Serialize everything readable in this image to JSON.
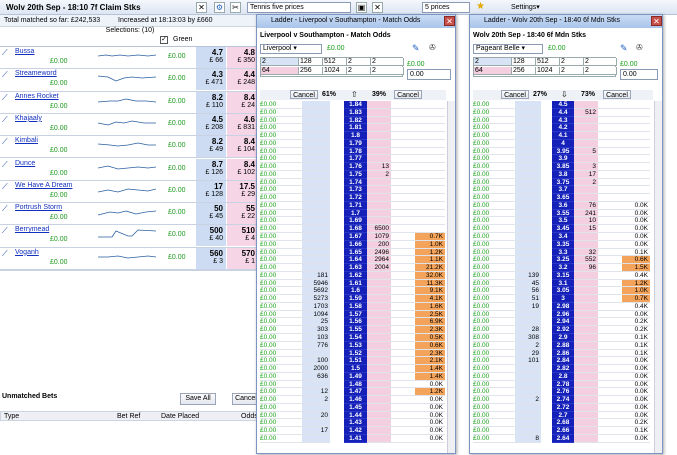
{
  "main": {
    "title": "Wolv 20th Sep - 18:10 7f Claim Stks",
    "total_matched": "Total matched so far: £242,533",
    "increased": "Increased at 18:13:03 by £660",
    "selections": "Selections: (10)",
    "green_label": "Green",
    "preset": "Tennis five prices",
    "preset2": "5 prices",
    "settings": "Settings",
    "runners": [
      {
        "name": "Bussa",
        "pl": "£0.00",
        "pl2": "£0.00",
        "back": "4.7",
        "back_size": "£ 66",
        "lay": "4.8",
        "lay_size": "£ 350"
      },
      {
        "name": "Streameword",
        "pl": "£0.00",
        "pl2": "£0.00",
        "back": "4.3",
        "back_size": "£ 471",
        "lay": "4.4",
        "lay_size": "£ 248"
      },
      {
        "name": "Annes Rocket",
        "pl": "£0.00",
        "pl2": "£0.00",
        "back": "8.2",
        "back_size": "£ 110",
        "lay": "8.4",
        "lay_size": "£ 24"
      },
      {
        "name": "Khajaaly",
        "pl": "£0.00",
        "pl2": "£0.00",
        "back": "4.5",
        "back_size": "£ 208",
        "lay": "4.6",
        "lay_size": "£ 831"
      },
      {
        "name": "Kimbali",
        "pl": "£0.00",
        "pl2": "£0.00",
        "back": "8.2",
        "back_size": "£ 49",
        "lay": "8.4",
        "lay_size": "£ 104"
      },
      {
        "name": "Dunce",
        "pl": "£0.00",
        "pl2": "£0.00",
        "back": "8.7",
        "back_size": "£ 126",
        "lay": "8.4",
        "lay_size": "£ 102"
      },
      {
        "name": "We Have A Dream",
        "pl": "£0.00",
        "pl2": "£0.00",
        "back": "17",
        "back_size": "£ 128",
        "lay": "17.5",
        "lay_size": "£ 29"
      },
      {
        "name": "Portrush Storm",
        "pl": "£0.00",
        "pl2": "£0.00",
        "back": "50",
        "back_size": "£ 45",
        "lay": "55",
        "lay_size": "£ 22"
      },
      {
        "name": "Berrymead",
        "pl": "£0.00",
        "pl2": "£0.00",
        "back": "500",
        "back_size": "£ 40",
        "lay": "510",
        "lay_size": "£ 4"
      },
      {
        "name": "Voganh",
        "pl": "£0.00",
        "pl2": "£0.00",
        "back": "560",
        "back_size": "£ 3",
        "lay": "570",
        "lay_size": "£ 1"
      }
    ],
    "unmatched_title": "Unmatched Bets",
    "save_all": "Save All",
    "cancel": "Cancel",
    "cols": [
      "Type",
      "Bet Ref",
      "Date Placed",
      "Odds"
    ]
  },
  "ladder1": {
    "title": "Ladder - Liverpool v Southampton - Match Odds",
    "market": "Liverpool v Southampton - Match Odds",
    "selection": "Liverpool",
    "pl": "£0.00",
    "stakes_row1": [
      "2",
      "128",
      "512",
      "2",
      "2"
    ],
    "stakes_row2": [
      "64",
      "256",
      "1024",
      "2",
      "2"
    ],
    "pl_box": "£0.00",
    "stake_box": "0.00",
    "cancel_l": "Cancel",
    "pct_back": "61%",
    "pct_lay": "39%",
    "cancel_r": "Cancel",
    "rows": [
      [
        "£0.00",
        "",
        "1.84",
        "",
        "",
        ""
      ],
      [
        "£0.00",
        "",
        "1.83",
        "",
        "",
        ""
      ],
      [
        "£0.00",
        "",
        "1.82",
        "",
        "",
        ""
      ],
      [
        "£0.00",
        "",
        "1.81",
        "",
        "",
        ""
      ],
      [
        "£0.00",
        "",
        "1.8",
        "",
        "",
        ""
      ],
      [
        "£0.00",
        "",
        "1.79",
        "",
        "",
        ""
      ],
      [
        "£0.00",
        "",
        "1.78",
        "",
        "",
        ""
      ],
      [
        "£0.00",
        "",
        "1.77",
        "",
        "",
        ""
      ],
      [
        "£0.00",
        "",
        "1.76",
        "13",
        "",
        ""
      ],
      [
        "£0.00",
        "",
        "1.75",
        "2",
        "",
        ""
      ],
      [
        "£0.00",
        "",
        "1.74",
        "",
        "",
        ""
      ],
      [
        "£0.00",
        "",
        "1.73",
        "",
        "",
        ""
      ],
      [
        "£0.00",
        "",
        "1.72",
        "",
        "",
        ""
      ],
      [
        "£0.00",
        "",
        "1.71",
        "",
        "",
        ""
      ],
      [
        "£0.00",
        "",
        "1.7",
        "",
        "",
        ""
      ],
      [
        "£0.00",
        "",
        "1.69",
        "",
        "",
        ""
      ],
      [
        "£0.00",
        "",
        "1.68",
        "6500",
        "",
        ""
      ],
      [
        "£0.00",
        "",
        "1.67",
        "1079",
        "",
        "0.7K"
      ],
      [
        "£0.00",
        "",
        "1.66",
        "200",
        "",
        "1.0K"
      ],
      [
        "£0.00",
        "",
        "1.65",
        "2496",
        "",
        "1.2K"
      ],
      [
        "£0.00",
        "",
        "1.64",
        "2964",
        "",
        "1.1K"
      ],
      [
        "£0.00",
        "",
        "1.63",
        "2004",
        "",
        "21.2K"
      ],
      [
        "£0.00",
        "181",
        "1.62",
        "",
        "",
        "32.0K"
      ],
      [
        "£0.00",
        "5946",
        "1.61",
        "",
        "",
        "11.3K"
      ],
      [
        "£0.00",
        "5692",
        "1.6",
        "",
        "",
        "9.1K"
      ],
      [
        "£0.00",
        "5273",
        "1.59",
        "",
        "",
        "4.1K"
      ],
      [
        "£0.00",
        "1703",
        "1.58",
        "",
        "",
        "1.6K"
      ],
      [
        "£0.00",
        "1094",
        "1.57",
        "",
        "",
        "2.5K"
      ],
      [
        "£0.00",
        "25",
        "1.56",
        "",
        "",
        "6.9K"
      ],
      [
        "£0.00",
        "303",
        "1.55",
        "",
        "",
        "2.3K"
      ],
      [
        "£0.00",
        "103",
        "1.54",
        "",
        "",
        "0.5K"
      ],
      [
        "£0.00",
        "776",
        "1.53",
        "",
        "",
        "0.6K"
      ],
      [
        "£0.00",
        "",
        "1.52",
        "",
        "",
        "2.3K"
      ],
      [
        "£0.00",
        "100",
        "1.51",
        "",
        "",
        "2.1K"
      ],
      [
        "£0.00",
        "2000",
        "1.5",
        "",
        "",
        "1.4K"
      ],
      [
        "£0.00",
        "636",
        "1.49",
        "",
        "",
        "1.4K"
      ],
      [
        "£0.00",
        "",
        "1.48",
        "",
        "",
        "0.0K"
      ],
      [
        "£0.00",
        "12",
        "1.47",
        "",
        "",
        "1.2K"
      ],
      [
        "£0.00",
        "2",
        "1.46",
        "",
        "",
        "0.0K"
      ],
      [
        "£0.00",
        "",
        "1.45",
        "",
        "",
        "0.0K"
      ],
      [
        "£0.00",
        "20",
        "1.44",
        "",
        "",
        "0.0K"
      ],
      [
        "£0.00",
        "",
        "1.43",
        "",
        "",
        "0.0K"
      ],
      [
        "£0.00",
        "17",
        "1.42",
        "",
        "",
        "0.0K"
      ],
      [
        "£0.00",
        "",
        "1.41",
        "",
        "",
        "0.0K"
      ]
    ]
  },
  "ladder2": {
    "title": "Ladder - Wolv 20th Sep - 18:40 6f Mdn Stks",
    "market": "Wolv 20th Sep - 18:40 6f Mdn Stks",
    "selection": "Pageant Belle",
    "pl": "£0.00",
    "stakes_row1": [
      "2",
      "128",
      "512",
      "2",
      "2"
    ],
    "stakes_row2": [
      "64",
      "256",
      "1024",
      "2",
      "2"
    ],
    "pl_box": "£0.00",
    "stake_box": "0.00",
    "cancel_l": "Cancel",
    "pct_back": "27%",
    "pct_lay": "73%",
    "cancel_r": "Cancel",
    "rows": [
      [
        "£0.00",
        "",
        "4.5",
        "",
        "",
        ""
      ],
      [
        "£0.00",
        "",
        "4.4",
        "512",
        "",
        ""
      ],
      [
        "£0.00",
        "",
        "4.3",
        "",
        "",
        ""
      ],
      [
        "£0.00",
        "",
        "4.2",
        "",
        "",
        ""
      ],
      [
        "£0.00",
        "",
        "4.1",
        "",
        "",
        ""
      ],
      [
        "£0.00",
        "",
        "4",
        "",
        "",
        ""
      ],
      [
        "£0.00",
        "",
        "3.95",
        "5",
        "",
        ""
      ],
      [
        "£0.00",
        "",
        "3.9",
        "",
        "",
        ""
      ],
      [
        "£0.00",
        "",
        "3.85",
        "3",
        "",
        ""
      ],
      [
        "£0.00",
        "",
        "3.8",
        "17",
        "",
        ""
      ],
      [
        "£0.00",
        "",
        "3.75",
        "2",
        "",
        ""
      ],
      [
        "£0.00",
        "",
        "3.7",
        "",
        "",
        ""
      ],
      [
        "£0.00",
        "",
        "3.65",
        "",
        "",
        ""
      ],
      [
        "£0.00",
        "",
        "3.6",
        "76",
        "",
        "0.0K"
      ],
      [
        "£0.00",
        "",
        "3.55",
        "241",
        "",
        "0.0K"
      ],
      [
        "£0.00",
        "",
        "3.5",
        "10",
        "",
        "0.0K"
      ],
      [
        "£0.00",
        "",
        "3.45",
        "15",
        "",
        "0.0K"
      ],
      [
        "£0.00",
        "",
        "3.4",
        "",
        "",
        "0.0K"
      ],
      [
        "£0.00",
        "",
        "3.35",
        "",
        "",
        "0.0K"
      ],
      [
        "£0.00",
        "",
        "3.3",
        "32",
        "",
        "0.1K"
      ],
      [
        "£0.00",
        "",
        "3.25",
        "552",
        "",
        "0.6K"
      ],
      [
        "£0.00",
        "",
        "3.2",
        "96",
        "",
        "1.5K"
      ],
      [
        "£0.00",
        "139",
        "3.15",
        "",
        "",
        "0.4K"
      ],
      [
        "£0.00",
        "45",
        "3.1",
        "",
        "",
        "1.2K"
      ],
      [
        "£0.00",
        "56",
        "3.05",
        "",
        "",
        "1.0K"
      ],
      [
        "£0.00",
        "51",
        "3",
        "",
        "",
        "0.7K"
      ],
      [
        "£0.00",
        "19",
        "2.98",
        "",
        "",
        "0.4K"
      ],
      [
        "£0.00",
        "",
        "2.96",
        "",
        "",
        "0.0K"
      ],
      [
        "£0.00",
        "",
        "2.94",
        "",
        "",
        "0.2K"
      ],
      [
        "£0.00",
        "28",
        "2.92",
        "",
        "",
        "0.2K"
      ],
      [
        "£0.00",
        "308",
        "2.9",
        "",
        "",
        "0.1K"
      ],
      [
        "£0.00",
        "2",
        "2.88",
        "",
        "",
        "0.1K"
      ],
      [
        "£0.00",
        "29",
        "2.86",
        "",
        "",
        "0.1K"
      ],
      [
        "£0.00",
        "101",
        "2.84",
        "",
        "",
        "0.0K"
      ],
      [
        "£0.00",
        "",
        "2.82",
        "",
        "",
        "0.0K"
      ],
      [
        "£0.00",
        "",
        "2.8",
        "",
        "",
        "0.0K"
      ],
      [
        "£0.00",
        "",
        "2.78",
        "",
        "",
        "0.0K"
      ],
      [
        "£0.00",
        "",
        "2.76",
        "",
        "",
        "0.0K"
      ],
      [
        "£0.00",
        "2",
        "2.74",
        "",
        "",
        "0.0K"
      ],
      [
        "£0.00",
        "",
        "2.72",
        "",
        "",
        "0.0K"
      ],
      [
        "£0.00",
        "",
        "2.7",
        "",
        "",
        "0.0K"
      ],
      [
        "£0.00",
        "",
        "2.68",
        "",
        "",
        "0.2K"
      ],
      [
        "£0.00",
        "",
        "2.66",
        "",
        "",
        "0.1K"
      ],
      [
        "£0.00",
        "8",
        "2.64",
        "",
        "",
        "0.0K"
      ]
    ]
  }
}
